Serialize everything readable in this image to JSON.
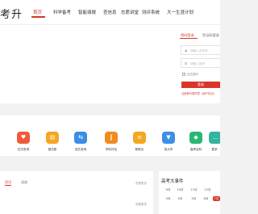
{
  "header": {
    "logo_text": "考升",
    "nav": [
      {
        "label": "首页",
        "active": true
      },
      {
        "label": "科学备考"
      },
      {
        "label": "智能填报"
      },
      {
        "label": "查信息"
      },
      {
        "label": "志愿讲堂"
      },
      {
        "label": "测评系统"
      },
      {
        "label": "大一生涯计划"
      }
    ]
  },
  "login": {
    "tabs": [
      "密码登录",
      "验证码登录"
    ],
    "phone_placeholder": "请输入手机号",
    "password_placeholder": "请输入密码",
    "remember_label": "记住密码",
    "submit_label": "登录",
    "agree_text": "注册即代表同意《用户协议》"
  },
  "functions": [
    {
      "label": "位次查询",
      "icon": "heart-shield-icon",
      "color": "#f05a3c",
      "glyph": "♥"
    },
    {
      "label": "报志愿",
      "icon": "bar-chart-icon",
      "color": "#f5a623",
      "glyph": "▤"
    },
    {
      "label": "选艺查询",
      "icon": "refresh-icon",
      "color": "#3a8ee6",
      "glyph": "⇆"
    },
    {
      "label": "学科评估",
      "icon": "pause-bars-icon",
      "color": "#f28a1e",
      "glyph": "‖"
    },
    {
      "label": "新职业",
      "icon": "stack-icon",
      "color": "#f2a81f",
      "glyph": "≡"
    },
    {
      "label": "找大学",
      "icon": "shirt-icon",
      "color": "#3b8fe8",
      "glyph": "▼"
    },
    {
      "label": "高考百科",
      "icon": "diamond-icon",
      "color": "#2bb673",
      "glyph": "◆"
    },
    {
      "label": "更多",
      "icon": "more-icon",
      "color": "#34b3a0",
      "glyph": "…"
    }
  ],
  "content": {
    "tabs": [
      "资讯",
      "动态"
    ],
    "more_label": "查看更多"
  },
  "events": {
    "title": "高考大事件",
    "months": [
      "9月",
      "10月",
      "11月",
      "12月",
      "3月",
      "4月",
      "5月",
      "6月",
      "7月"
    ],
    "active_month": "7月"
  }
}
